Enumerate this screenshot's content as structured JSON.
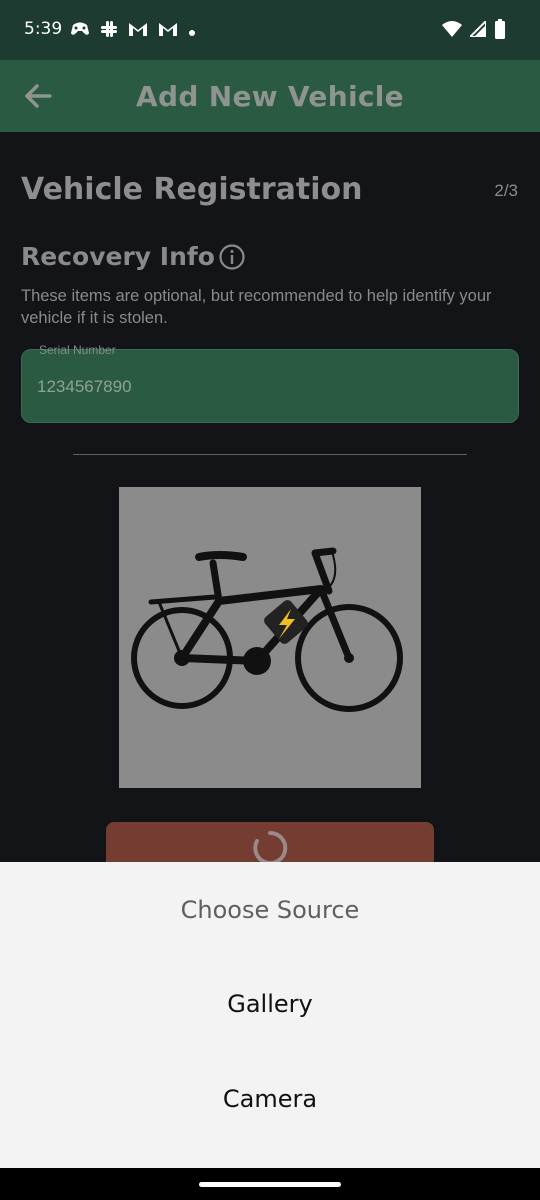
{
  "status_bar": {
    "time": "5:39",
    "left_icons": [
      "game-controller-icon",
      "slack-icon",
      "gmail-icon",
      "gmail-icon",
      "dot-icon"
    ],
    "right_icons": [
      "wifi-icon",
      "cell-signal-icon",
      "battery-icon"
    ]
  },
  "app_bar": {
    "title": "Add New Vehicle",
    "back_icon": "arrow-back-icon"
  },
  "form": {
    "section_title": "Vehicle Registration",
    "step": "2/3",
    "sub_title": "Recovery Info",
    "description": "These items are optional, but recommended to help identify your vehicle if it is stolen.",
    "serial_label": "Serial Number",
    "serial_value": "1234567890",
    "image_icon": "electric-bike-icon",
    "submit_state_icon": "loading-spinner-icon"
  },
  "sheet": {
    "title": "Choose Source",
    "options": [
      "Gallery",
      "Camera"
    ]
  },
  "colors": {
    "status_bar": "#1d3b30",
    "app_bar": "#2a5a41",
    "background": "#121418",
    "button": "#753c32",
    "sheet": "#f3f3f3"
  }
}
